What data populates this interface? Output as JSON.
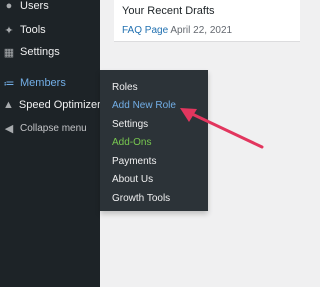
{
  "sidebar": {
    "items": [
      {
        "label": "Users",
        "icon": "users-icon"
      },
      {
        "label": "Tools",
        "icon": "tools-icon"
      },
      {
        "label": "Settings",
        "icon": "settings-icon"
      },
      {
        "label": "Members",
        "icon": "members-icon",
        "current": true
      },
      {
        "label": "Speed Optimizer",
        "icon": "speed-optimizer-icon"
      },
      {
        "label": "Collapse menu",
        "icon": "collapse-icon"
      }
    ]
  },
  "submenu": {
    "items": [
      {
        "label": "Roles"
      },
      {
        "label": "Add New Role",
        "active": true
      },
      {
        "label": "Settings"
      },
      {
        "label": "Add-Ons",
        "highlight": true
      },
      {
        "label": "Payments"
      },
      {
        "label": "About Us"
      },
      {
        "label": "Growth Tools"
      }
    ]
  },
  "drafts": {
    "title": "Your Recent Drafts",
    "items": [
      {
        "title": "FAQ Page",
        "date": "April 22, 2021"
      }
    ]
  },
  "colors": {
    "sidebar_bg": "#1d2327",
    "submenu_bg": "#2c3338",
    "accent": "#72aee6",
    "link": "#2271b1",
    "highlight": "#78c850",
    "arrow": "#e2365e"
  }
}
